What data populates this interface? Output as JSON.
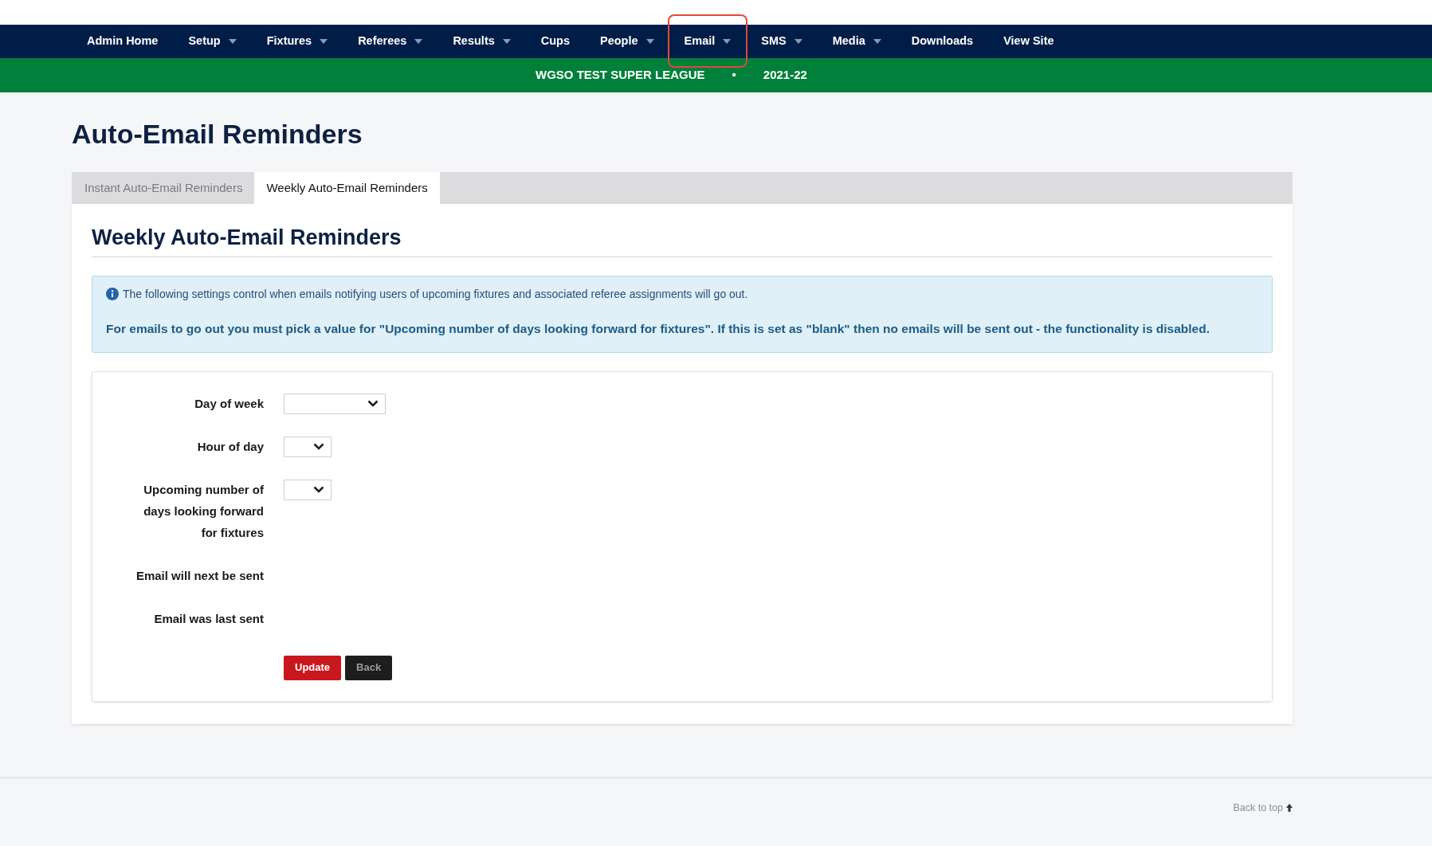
{
  "nav": [
    {
      "label": "Admin Home",
      "has_menu": false,
      "highlighted": false
    },
    {
      "label": "Setup",
      "has_menu": true,
      "highlighted": false
    },
    {
      "label": "Fixtures",
      "has_menu": true,
      "highlighted": false
    },
    {
      "label": "Referees",
      "has_menu": true,
      "highlighted": false
    },
    {
      "label": "Results",
      "has_menu": true,
      "highlighted": false
    },
    {
      "label": "Cups",
      "has_menu": false,
      "highlighted": false
    },
    {
      "label": "People",
      "has_menu": true,
      "highlighted": false
    },
    {
      "label": "Email",
      "has_menu": true,
      "highlighted": true
    },
    {
      "label": "SMS",
      "has_menu": true,
      "highlighted": false
    },
    {
      "label": "Media",
      "has_menu": true,
      "highlighted": false
    },
    {
      "label": "Downloads",
      "has_menu": false,
      "highlighted": false
    },
    {
      "label": "View Site",
      "has_menu": false,
      "highlighted": false
    }
  ],
  "league_bar": {
    "league": "WGSO TEST SUPER LEAGUE",
    "separator": "•",
    "season": "2021-22"
  },
  "page_title": "Auto-Email Reminders",
  "tabs": [
    {
      "label": "Instant Auto-Email Reminders",
      "selected": false
    },
    {
      "label": "Weekly Auto-Email Reminders",
      "selected": true
    }
  ],
  "section_title": "Weekly Auto-Email Reminders",
  "info": {
    "line_1": "The following settings control when emails notifying users of upcoming fixtures and associated referee assignments will go out.",
    "line_2": "For emails to go out you must pick a value for \"Upcoming number of days looking forward for fixtures\". If this is set as \"blank\" then no emails will be sent out - the functionality is disabled."
  },
  "form": [
    {
      "label": "Day of week",
      "kind": "select-wide"
    },
    {
      "label": "Hour of day",
      "kind": "select"
    },
    {
      "label": "Upcoming number of days looking forward for fixtures",
      "kind": "select"
    },
    {
      "label": "Email will next be sent",
      "kind": "text"
    },
    {
      "label": "Email was last sent",
      "kind": "text"
    }
  ],
  "buttons": [
    {
      "label": "Update",
      "kind": "primary"
    },
    {
      "label": "Back",
      "kind": "secondary"
    }
  ],
  "footer": {
    "back_to_top": "Back to top"
  }
}
